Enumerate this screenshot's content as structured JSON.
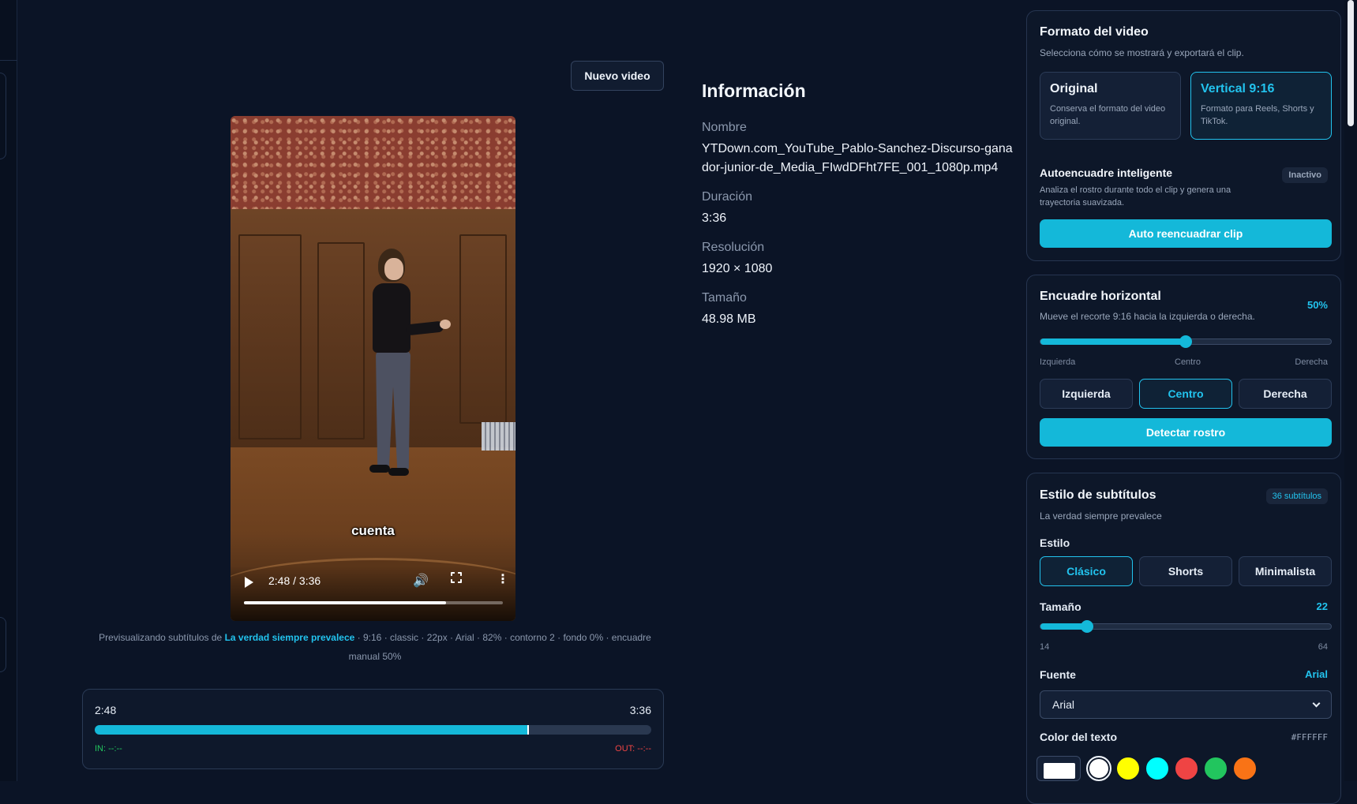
{
  "header": {
    "new_video_label": "Nuevo video"
  },
  "player": {
    "caption": "cuenta",
    "time_display": "2:48 / 3:36",
    "progress": 0.78,
    "icons": [
      "play-icon",
      "volume-icon",
      "fullscreen-icon",
      "more-vert-icon"
    ]
  },
  "preview": {
    "prefix": "Previsualizando subtítulos de",
    "project": "La verdad siempre prevalece",
    "details": "· 9:16 · classic · 22px · Arial · 82% · contorno 2 · fondo 0% · encuadre manual 50%"
  },
  "trim": {
    "start": "2:48",
    "end": "3:36",
    "in_label": "IN: --:--",
    "out_label": "OUT: --:--",
    "progress": 0.778
  },
  "info": {
    "title": "Información",
    "name_label": "Nombre",
    "name_value": "YTDown.com_YouTube_Pablo-Sanchez-Discurso-ganador-junior-de_Media_FIwdDFht7FE_001_1080p.mp4",
    "duration_label": "Duración",
    "duration_value": "3:36",
    "resolution_label": "Resolución",
    "resolution_value": "1920 × 1080",
    "size_label": "Tamaño",
    "size_value": "48.98 MB"
  },
  "format": {
    "title": "Formato del video",
    "subtitle": "Selecciona cómo se mostrará y exportará el clip.",
    "original_title": "Original",
    "original_desc": "Conserva el formato del video original.",
    "vertical_title": "Vertical 9:16",
    "vertical_desc": "Formato para Reels, Shorts y TikTok.",
    "auto_title": "Autoencuadre inteligente",
    "auto_status": "Inactivo",
    "auto_desc": "Analiza el rostro durante todo el clip y genera una trayectoria suavizada.",
    "auto_button": "Auto reencuadrar clip"
  },
  "framing": {
    "title": "Encuadre horizontal",
    "subtitle": "Mueve el recorte 9:16 hacia la izquierda o derecha.",
    "value_label": "50%",
    "value": 0.5,
    "tick_left": "Izquierda",
    "tick_center": "Centro",
    "tick_right": "Derecha",
    "btn_left": "Izquierda",
    "btn_center": "Centro",
    "btn_right": "Derecha",
    "detect_button": "Detectar rostro"
  },
  "subtitles": {
    "title": "Estilo de subtítulos",
    "count_badge": "36 subtítulos",
    "project": "La verdad siempre prevalece",
    "style_label": "Estilo",
    "style_options": [
      "Clásico",
      "Shorts",
      "Minimalista"
    ],
    "size_label": "Tamaño",
    "size_value": "22",
    "size_min": "14",
    "size_max": "64",
    "size_fraction": 0.16,
    "font_label": "Fuente",
    "font_value_label": "Arial",
    "font_selected": "Arial",
    "color_label": "Color del texto",
    "color_hex": "#FFFFFF",
    "swatches": [
      "#ffffff",
      "#ffff00",
      "#00ffff",
      "#ef4444",
      "#22c55e",
      "#f97316"
    ]
  },
  "colors": {
    "accent": "#14b8d9",
    "background": "#0b1426"
  }
}
